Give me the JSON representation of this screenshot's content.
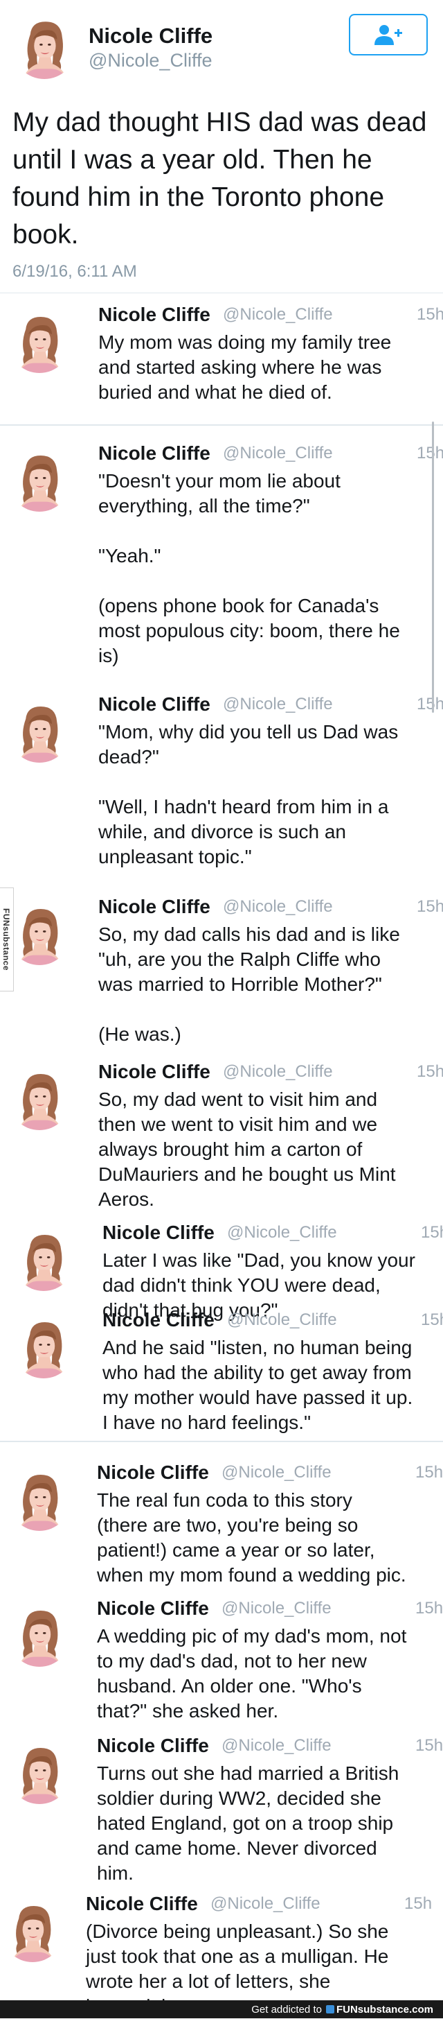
{
  "main_tweet": {
    "name": "Nicole Cliffe",
    "handle": "@Nicole_Cliffe",
    "text": "My dad thought HIS dad was dead until I was a year old. Then he found him in the Toronto phone book.",
    "timestamp": "6/19/16, 6:11 AM"
  },
  "replies": [
    {
      "name": "Nicole Cliffe",
      "handle": "@Nicole_Cliffe",
      "time": "15h",
      "text": "My mom was doing my family tree\nand started asking where he was\nburied and what he died of."
    },
    {
      "name": "Nicole Cliffe",
      "handle": "@Nicole_Cliffe",
      "time": "15h",
      "text": "\"Doesn't your mom lie about\neverything, all the time?\"\n\n\"Yeah.\"\n\n(opens phone book for Canada's\nmost populous city: boom, there he\nis)"
    },
    {
      "name": "Nicole Cliffe",
      "handle": "@Nicole_Cliffe",
      "time": "15h",
      "text": "\"Mom, why did you tell us Dad was\ndead?\"\n\n\"Well, I hadn't heard from him in a\nwhile, and divorce is such an\nunpleasant topic.\""
    },
    {
      "name": "Nicole Cliffe",
      "handle": "@Nicole_Cliffe",
      "time": "15h",
      "text": "So, my dad calls his dad and is like\n\"uh, are you the Ralph Cliffe who\nwas married to Horrible Mother?\"\n\n(He was.)"
    },
    {
      "name": "Nicole Cliffe",
      "handle": "@Nicole_Cliffe",
      "time": "15h",
      "text": "So, my dad went to visit him and\nthen we went to visit him and we\nalways brought him a carton of\nDuMauriers and he bought us Mint\nAeros."
    },
    {
      "name": "Nicole Cliffe",
      "handle": "@Nicole_Cliffe",
      "time": "15h",
      "text": "Later I was like \"Dad, you know your\ndad didn't think YOU were dead,\ndidn't that bug you?\""
    },
    {
      "name": "Nicole Cliffe",
      "handle": "@Nicole_Cliffe",
      "time": "15h",
      "text": "And he said \"listen, no human being\nwho had the ability to get away from\nmy mother would have passed it up.\nI have no hard feelings.\""
    },
    {
      "name": "Nicole Cliffe",
      "handle": "@Nicole_Cliffe",
      "time": "15h",
      "text": "The real fun coda to this story\n(there are two, you're being so\npatient!) came a year or so later,\nwhen my mom found a wedding pic."
    },
    {
      "name": "Nicole Cliffe",
      "handle": "@Nicole_Cliffe",
      "time": "15h",
      "text": "A wedding pic of my dad's mom, not\nto my dad's dad, not to her new\nhusband. An older one. \"Who's\nthat?\" she asked her."
    },
    {
      "name": "Nicole Cliffe",
      "handle": "@Nicole_Cliffe",
      "time": "15h",
      "text": "Turns out she had married a British\nsoldier during WW2, decided she\nhated England, got on a troop ship\nand came home. Never divorced\nhim."
    },
    {
      "name": "Nicole Cliffe",
      "handle": "@Nicole_Cliffe",
      "time": "15h",
      "text": "(Divorce being unpleasant.) So she\njust took that one as a mulligan. He\nwrote her a lot of letters, she\nignored them."
    }
  ],
  "side_watermark": "FUNsubstance",
  "footer": {
    "prefix": "Get addicted to",
    "brand_fun": "FUN",
    "brand_rest": "substance.com"
  },
  "colors": {
    "accent": "#1da1f2",
    "muted": "#8899a6",
    "divider": "#e1e8ed",
    "footer_bg": "#1a1a1a"
  },
  "icons": {
    "follow": "add-user-icon",
    "avatar": "avatar"
  }
}
